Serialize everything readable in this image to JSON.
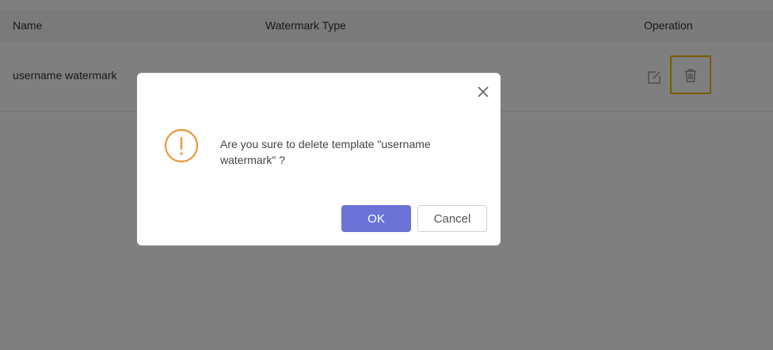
{
  "table": {
    "columns": [
      "Name",
      "Watermark Type",
      "Operation"
    ],
    "rows": [
      {
        "name": "username watermark",
        "type": ""
      }
    ]
  },
  "icons": {
    "edit": "edit-icon",
    "delete": "trash-icon",
    "close": "close-icon",
    "warning": "exclamation-circle-icon"
  },
  "colors": {
    "accent": "#6b74d6",
    "warning": "#f0953a",
    "highlight": "#f5b800"
  },
  "dialog": {
    "message": "Are you sure to delete template \"username watermark\" ?",
    "ok_label": "OK",
    "cancel_label": "Cancel"
  }
}
